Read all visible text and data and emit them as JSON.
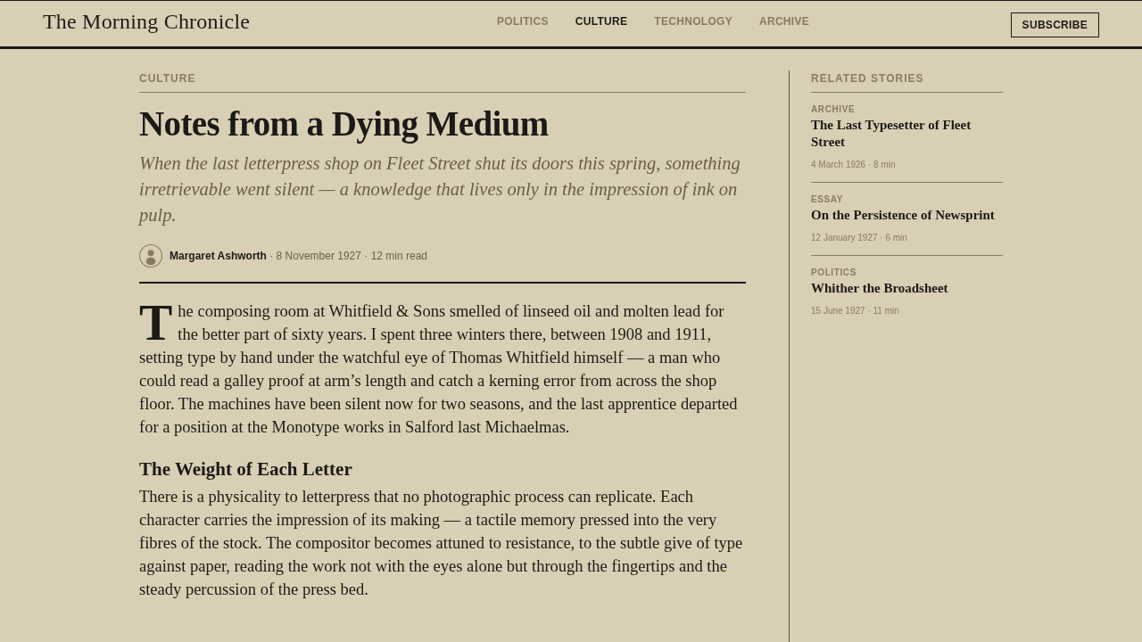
{
  "masthead": {
    "title": "The Morning Chronicle"
  },
  "nav": [
    {
      "label": "POLITICS",
      "selected": false
    },
    {
      "label": "CULTURE",
      "selected": true
    },
    {
      "label": "TECHNOLOGY",
      "selected": false
    },
    {
      "label": "ARCHIVE",
      "selected": false
    }
  ],
  "subscribe_button": "SUBSCRIBE",
  "article": {
    "section": "CULTURE",
    "headline": "Notes from a Dying Medium",
    "dek": "When the last letterpress shop on Fleet Street shut its doors this spring, something irretrievable went silent — a knowledge that lives only in the impression of ink on pulp.",
    "byline": "**Margaret Ashworth** · 8 November 1927 · 12 min read",
    "body": [
      {
        "kind": "paragraph",
        "drop_cap": true,
        "text": "The composing room at Whitfield & Sons smelled of linseed oil and molten lead for the better part of sixty years. I spent three winters there, between 1908 and 1911, setting type by hand under the watchful eye of Thomas Whitfield himself — a man who could read a galley proof at arm’s length and catch a kerning error from across the shop floor. The machines have been silent now for two seasons, and the last apprentice departed for a position at the Monotype works in Salford last Michaelmas."
      },
      {
        "kind": "heading",
        "text": "The Weight of Each Letter"
      },
      {
        "kind": "paragraph",
        "drop_cap": false,
        "text": "There is a physicality to letterpress that no photographic process can replicate. Each character carries the impression of its making — a tactile memory pressed into the very fibres of the stock. The compositor becomes attuned to resistance, to the subtle give of type against paper, reading the work not with the eyes alone but through the fingertips and the steady percussion of the press bed."
      }
    ]
  },
  "sidebar": {
    "title": "RELATED STORIES",
    "stories": [
      {
        "category": "ARCHIVE",
        "title": "The Last Typesetter of Fleet Street",
        "meta": "4 March 1926 · 8 min"
      },
      {
        "category": "ESSAY",
        "title": "On the Persistence of Newsprint",
        "meta": "12 January 1927 · 6 min"
      },
      {
        "category": "POLITICS",
        "title": "Whither the Broadsheet",
        "meta": "15 June 1927 · 11 min"
      }
    ]
  }
}
